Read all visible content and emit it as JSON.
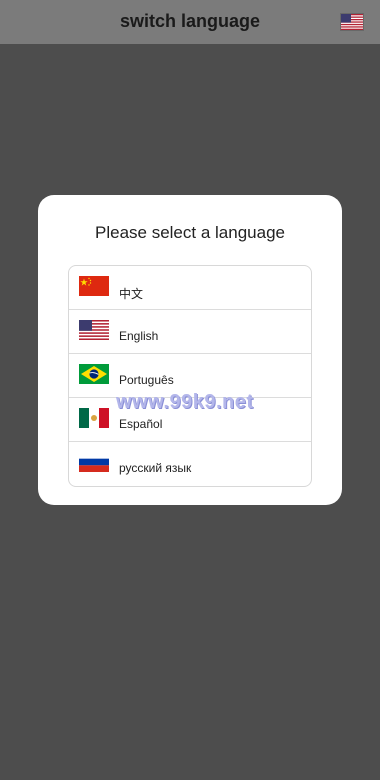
{
  "header": {
    "title": "switch language",
    "current_flag_icon": "us-flag-icon"
  },
  "modal": {
    "title": "Please select a language",
    "languages": [
      {
        "label": "中文",
        "flag_icon": "china-flag-icon"
      },
      {
        "label": "English",
        "flag_icon": "us-flag-icon"
      },
      {
        "label": "Português",
        "flag_icon": "brazil-flag-icon"
      },
      {
        "label": "Español",
        "flag_icon": "mexico-flag-icon"
      },
      {
        "label": "русский язык",
        "flag_icon": "russia-flag-icon"
      }
    ]
  },
  "watermark": "www.99k9.net",
  "colors": {
    "overlay": "#4d4d4d",
    "modal_bg": "#ffffff",
    "divider": "#dcdcdc"
  }
}
